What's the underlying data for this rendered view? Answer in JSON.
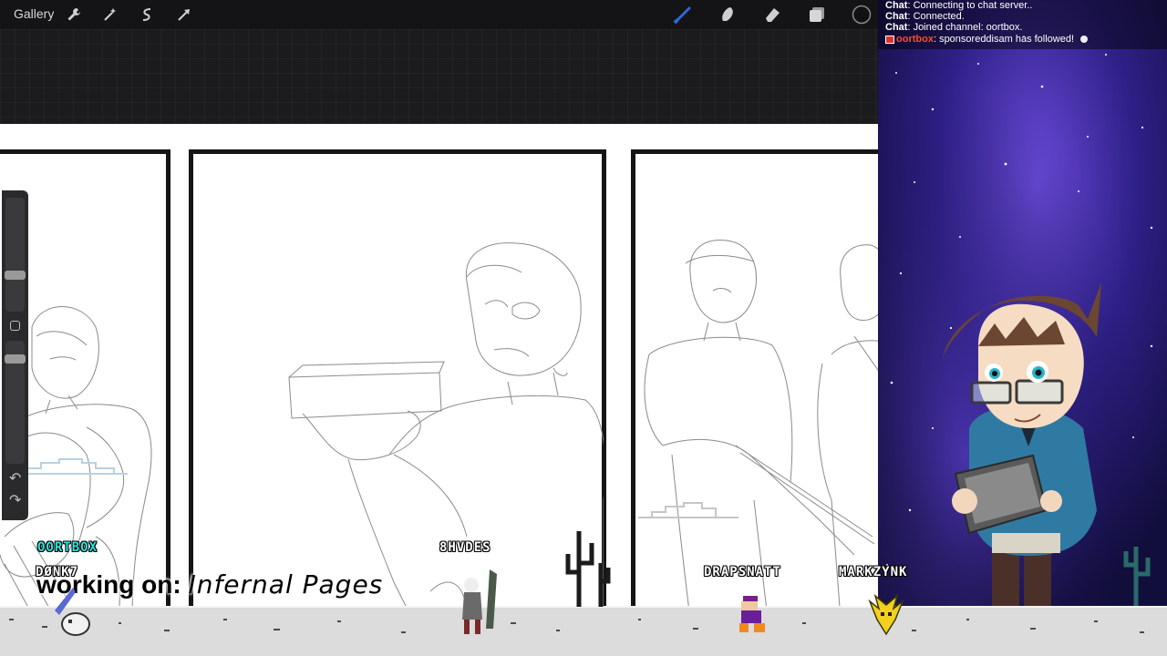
{
  "toolbar": {
    "gallery_label": "Gallery",
    "tools": [
      "wrench-icon",
      "magic-wand-icon",
      "selection-icon",
      "transform-icon"
    ],
    "right_tools": [
      "brush-icon",
      "smudge-icon",
      "eraser-icon",
      "layers-icon",
      "color-icon"
    ],
    "active_color": "#2a6bd8"
  },
  "chat": {
    "lines": [
      {
        "prefix": "Chat",
        "text": ": Connecting to chat server.."
      },
      {
        "prefix": "Chat",
        "text": ": Connected."
      },
      {
        "prefix": "Chat",
        "text": ": Joined channel: oortbox."
      },
      {
        "prefix": "oortbox",
        "text": ": sponsoreddisam has followed!"
      }
    ]
  },
  "overlay": {
    "working_label": "working on:",
    "project_name": "Infernal Pages",
    "viewers": [
      "OORTBOX",
      "DØNK7",
      "8HVDES",
      "DRAPSNATT",
      "MARKZYNK"
    ],
    "oortbox_color": "#2de3e0"
  }
}
